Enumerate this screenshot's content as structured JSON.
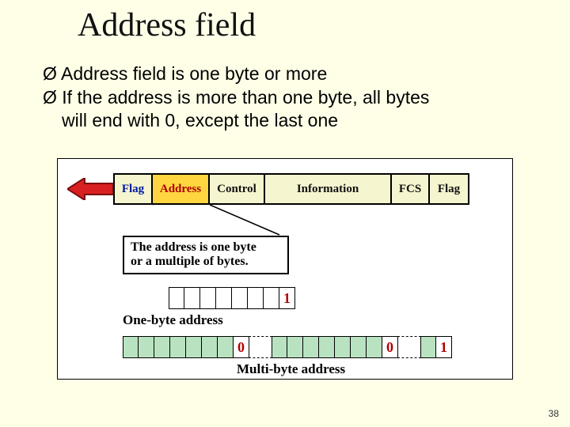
{
  "title": "Address field",
  "bullets": {
    "glyph": "Ø",
    "items": [
      "Address field is one byte or more",
      "If the address is more than one byte, all bytes"
    ],
    "continuation": "will end with 0, except the last one"
  },
  "fields": {
    "flag": "Flag",
    "address": "Address",
    "control": "Control",
    "information": "Information",
    "fcs": "FCS",
    "flag2": "Flag"
  },
  "callout": {
    "line1": "The address is one byte",
    "line2": "or a multiple of bytes."
  },
  "labels": {
    "one_byte": "One-byte address",
    "multi_byte": "Multi-byte address"
  },
  "bits": {
    "one": "1",
    "zero": "0"
  },
  "page_number": "38"
}
